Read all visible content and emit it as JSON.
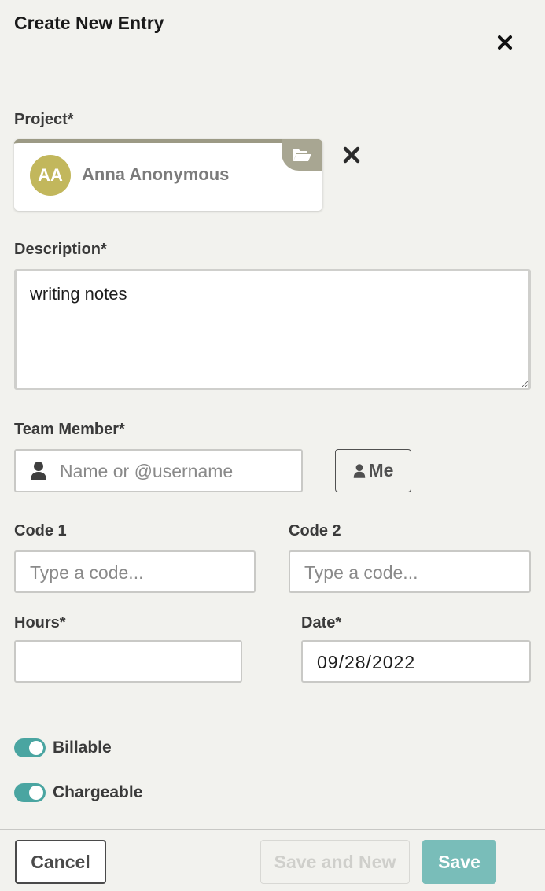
{
  "dialog": {
    "title": "Create New Entry",
    "close_icon": "close-icon"
  },
  "project": {
    "label": "Project*",
    "avatar_initials": "AA",
    "avatar_color": "#c2b75c",
    "name": "Anna Anonymous",
    "folder_icon": "folder-open-icon",
    "clear_icon": "close-icon"
  },
  "description": {
    "label": "Description*",
    "value": "writing notes"
  },
  "team_member": {
    "label": "Team Member*",
    "placeholder": "Name or @username",
    "user_icon": "user-icon",
    "me_button_label": "Me"
  },
  "code1": {
    "label": "Code 1",
    "placeholder": "Type a code..."
  },
  "code2": {
    "label": "Code 2",
    "placeholder": "Type a code..."
  },
  "hours": {
    "label": "Hours*",
    "value": ""
  },
  "date": {
    "label": "Date*",
    "value": "09/28/2022"
  },
  "toggles": [
    {
      "label": "Billable",
      "on": true
    },
    {
      "label": "Chargeable",
      "on": true
    }
  ],
  "footer": {
    "cancel_label": "Cancel",
    "save_and_new_label": "Save and New",
    "save_label": "Save"
  },
  "colors": {
    "accent_teal": "#4aa5a1",
    "save_button": "#79bdb9",
    "project_tab": "#a8a692"
  }
}
